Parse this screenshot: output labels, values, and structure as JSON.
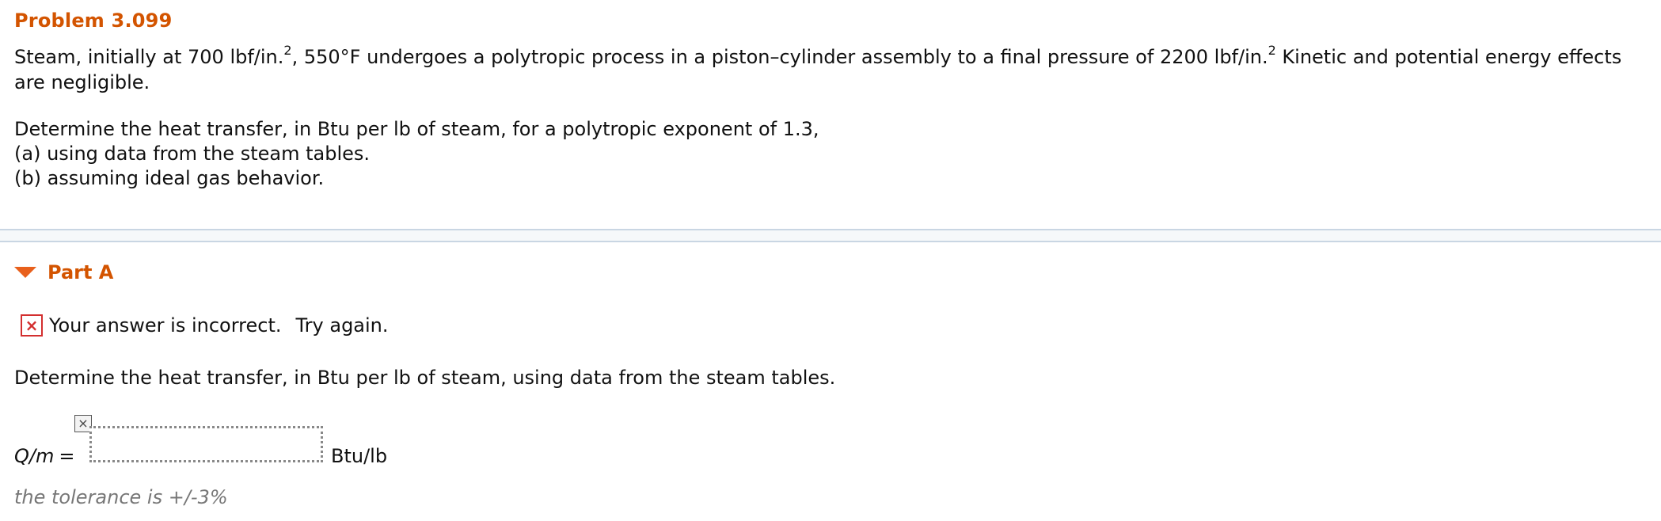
{
  "problem": {
    "title": "Problem 3.099",
    "statement_parts": [
      "Steam, initially at 700 lbf/in.",
      "2",
      ", 550°F undergoes a polytropic process in a piston–cylinder assembly to a final pressure of 2200 lbf/in.",
      "2",
      " Kinetic and potential energy effects are negligible."
    ],
    "question_lines": [
      "Determine the heat transfer, in Btu per lb of steam, for a polytropic exponent of 1.3,",
      "(a) using data from the steam tables.",
      "(b) assuming ideal gas behavior."
    ]
  },
  "part_a": {
    "label": "Part A",
    "feedback_icon": "×",
    "feedback_text": "Your answer is incorrect.",
    "feedback_retry": "Try again.",
    "prompt": "Determine the heat transfer, in Btu per lb of steam, using data from the steam tables.",
    "answer_label": "Q/m",
    "answer_equals": "=",
    "answer_value": "",
    "clear_icon": "×",
    "unit": "Btu/lb",
    "tolerance": "the tolerance is +/-3%"
  },
  "colors": {
    "accent": "#d35400",
    "error": "#d32f2f",
    "divider": "#c9d6e3"
  }
}
